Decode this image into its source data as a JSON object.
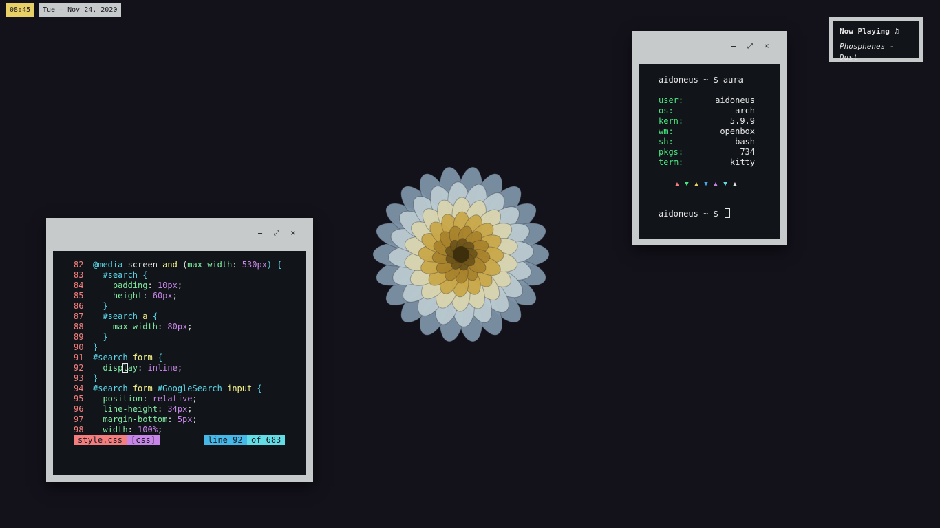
{
  "bar": {
    "time": "08:45",
    "date": "Tue — Nov 24, 2020"
  },
  "now_playing": {
    "title": "Now Playing ♫",
    "track": "Phosphenes - Dust"
  },
  "window_controls": {
    "minimize": "🗕",
    "maximize": "⤢",
    "close": "×"
  },
  "editor": {
    "code": [
      [
        [
          "82 ",
          "ln"
        ],
        [
          "@media",
          "kw"
        ],
        [
          " screen ",
          "pu"
        ],
        [
          "and",
          "id"
        ],
        [
          " (",
          "pu"
        ],
        [
          "max-width",
          "pr"
        ],
        [
          ": ",
          "pu"
        ],
        [
          "530px",
          "nu"
        ],
        [
          ") {",
          "kw"
        ]
      ],
      [
        [
          "83 ",
          "ln"
        ],
        [
          "  ",
          "pu"
        ],
        [
          "#search",
          "kw"
        ],
        [
          " {",
          "kw"
        ]
      ],
      [
        [
          "84 ",
          "ln"
        ],
        [
          "    ",
          "pu"
        ],
        [
          "padding",
          "pr"
        ],
        [
          ": ",
          "pu"
        ],
        [
          "10px",
          "nu"
        ],
        [
          ";",
          "pu"
        ]
      ],
      [
        [
          "85 ",
          "ln"
        ],
        [
          "    ",
          "pu"
        ],
        [
          "height",
          "pr"
        ],
        [
          ": ",
          "pu"
        ],
        [
          "60px",
          "nu"
        ],
        [
          ";",
          "pu"
        ]
      ],
      [
        [
          "86 ",
          "ln"
        ],
        [
          "  }",
          "kw"
        ]
      ],
      [
        [
          "87 ",
          "ln"
        ],
        [
          "  ",
          "pu"
        ],
        [
          "#search",
          "kw"
        ],
        [
          " ",
          "pu"
        ],
        [
          "a",
          "id"
        ],
        [
          " {",
          "kw"
        ]
      ],
      [
        [
          "88 ",
          "ln"
        ],
        [
          "    ",
          "pu"
        ],
        [
          "max-width",
          "pr"
        ],
        [
          ": ",
          "pu"
        ],
        [
          "80px",
          "nu"
        ],
        [
          ";",
          "pu"
        ]
      ],
      [
        [
          "89 ",
          "ln"
        ],
        [
          "  }",
          "kw"
        ]
      ],
      [
        [
          "90 ",
          "ln"
        ],
        [
          "}",
          "kw"
        ]
      ],
      [
        [
          "91 ",
          "ln"
        ],
        [
          "#search",
          "kw"
        ],
        [
          " ",
          "pu"
        ],
        [
          "form",
          "id"
        ],
        [
          " {",
          "kw"
        ]
      ],
      [
        [
          "92 ",
          "ln"
        ],
        [
          "  ",
          "pu"
        ],
        [
          "disp",
          "pr"
        ],
        [
          "l",
          "cur"
        ],
        [
          "ay",
          "pr"
        ],
        [
          ": ",
          "pu"
        ],
        [
          "inline",
          "nu"
        ],
        [
          ";",
          "pu"
        ]
      ],
      [
        [
          "93 ",
          "ln"
        ],
        [
          "}",
          "kw"
        ]
      ],
      [
        [
          "94 ",
          "ln"
        ],
        [
          "#search",
          "kw"
        ],
        [
          " ",
          "pu"
        ],
        [
          "form",
          "id"
        ],
        [
          " ",
          "pu"
        ],
        [
          "#GoogleSearch",
          "kw"
        ],
        [
          " ",
          "pu"
        ],
        [
          "input",
          "id"
        ],
        [
          " {",
          "kw"
        ]
      ],
      [
        [
          "95 ",
          "ln"
        ],
        [
          "  ",
          "pu"
        ],
        [
          "position",
          "pr"
        ],
        [
          ": ",
          "pu"
        ],
        [
          "relative",
          "nu"
        ],
        [
          ";",
          "pu"
        ]
      ],
      [
        [
          "96 ",
          "ln"
        ],
        [
          "  ",
          "pu"
        ],
        [
          "line-height",
          "pr"
        ],
        [
          ": ",
          "pu"
        ],
        [
          "34px",
          "nu"
        ],
        [
          ";",
          "pu"
        ]
      ],
      [
        [
          "97 ",
          "ln"
        ],
        [
          "  ",
          "pu"
        ],
        [
          "margin-bottom",
          "pr"
        ],
        [
          ": ",
          "pu"
        ],
        [
          "5px",
          "nu"
        ],
        [
          ";",
          "pu"
        ]
      ],
      [
        [
          "98 ",
          "ln"
        ],
        [
          "  ",
          "pu"
        ],
        [
          "width",
          "pr"
        ],
        [
          ": ",
          "pu"
        ],
        [
          "100%",
          "nu"
        ],
        [
          ";",
          "pu"
        ]
      ]
    ],
    "status": {
      "file": "style.css",
      "type": "[css]",
      "line": "line 92",
      "of": "of 683"
    }
  },
  "terminal": {
    "prompt1": "aidoneus ~ $ aura",
    "info": [
      {
        "key": "user:",
        "value": "aidoneus"
      },
      {
        "key": "os:",
        "value": "arch"
      },
      {
        "key": "kern:",
        "value": "5.9.9"
      },
      {
        "key": "wm:",
        "value": "openbox"
      },
      {
        "key": "sh:",
        "value": "bash"
      },
      {
        "key": "pkgs:",
        "value": "734"
      },
      {
        "key": "term:",
        "value": "kitty"
      }
    ],
    "triangles": [
      {
        "glyph": "▲",
        "color": "#f47e7e"
      },
      {
        "glyph": "▼",
        "color": "#48e880"
      },
      {
        "glyph": "▲",
        "color": "#e8cf66"
      },
      {
        "glyph": "▼",
        "color": "#46a8e8"
      },
      {
        "glyph": "▲",
        "color": "#c785e8"
      },
      {
        "glyph": "▼",
        "color": "#62dde5"
      },
      {
        "glyph": "▲",
        "color": "#e6e6e6"
      }
    ],
    "prompt2": "aidoneus ~ $ "
  }
}
